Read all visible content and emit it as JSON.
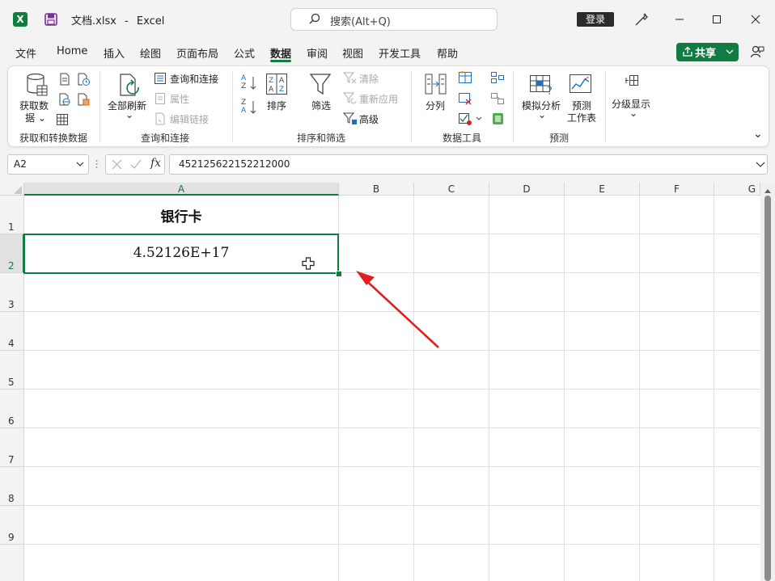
{
  "titlebar": {
    "filename": "文档.xlsx",
    "separator": "-",
    "app_name": "Excel",
    "search_placeholder": "搜索(Alt+Q)",
    "login_label": "登录"
  },
  "menu": {
    "items": [
      "文件",
      "Home",
      "插入",
      "绘图",
      "页面布局",
      "公式",
      "数据",
      "审阅",
      "视图",
      "开发工具",
      "帮助"
    ],
    "active": "数据",
    "share_label": "共享"
  },
  "ribbon": {
    "groups": [
      {
        "label": "获取和转换数据",
        "buttons": [
          "获取数",
          "据"
        ]
      },
      {
        "label": "查询和连接",
        "buttons": [
          "全部刷新",
          "查询和连接",
          "属性",
          "编辑链接"
        ]
      },
      {
        "label": "排序和筛选",
        "buttons": [
          "排序",
          "筛选",
          "清除",
          "重新应用",
          "高级"
        ]
      },
      {
        "label": "数据工具",
        "buttons": [
          "分列"
        ]
      },
      {
        "label": "预测",
        "buttons": [
          "模拟分析",
          "预测",
          "工作表"
        ]
      },
      {
        "label": "",
        "buttons": [
          "分级显示"
        ]
      }
    ],
    "sort_az_top": "A",
    "sort_az_bottom": "Z",
    "sort_za_top": "Z",
    "sort_za_bottom": "A"
  },
  "formula_bar": {
    "name_box": "A2",
    "fx_label": "fx",
    "value": "452125622152212000"
  },
  "sheet": {
    "columns": [
      "A",
      "B",
      "C",
      "D",
      "E",
      "F",
      "G"
    ],
    "selected_column": "A",
    "rows": [
      "1",
      "2",
      "3",
      "4",
      "5",
      "6",
      "7",
      "8",
      "9"
    ],
    "selected_row": "2",
    "cells": {
      "A1": "银行卡",
      "A2": "4.52126E+17"
    }
  },
  "annotation": {
    "arrow_color": "#e02020"
  },
  "colors": {
    "accent": "#107c41"
  }
}
